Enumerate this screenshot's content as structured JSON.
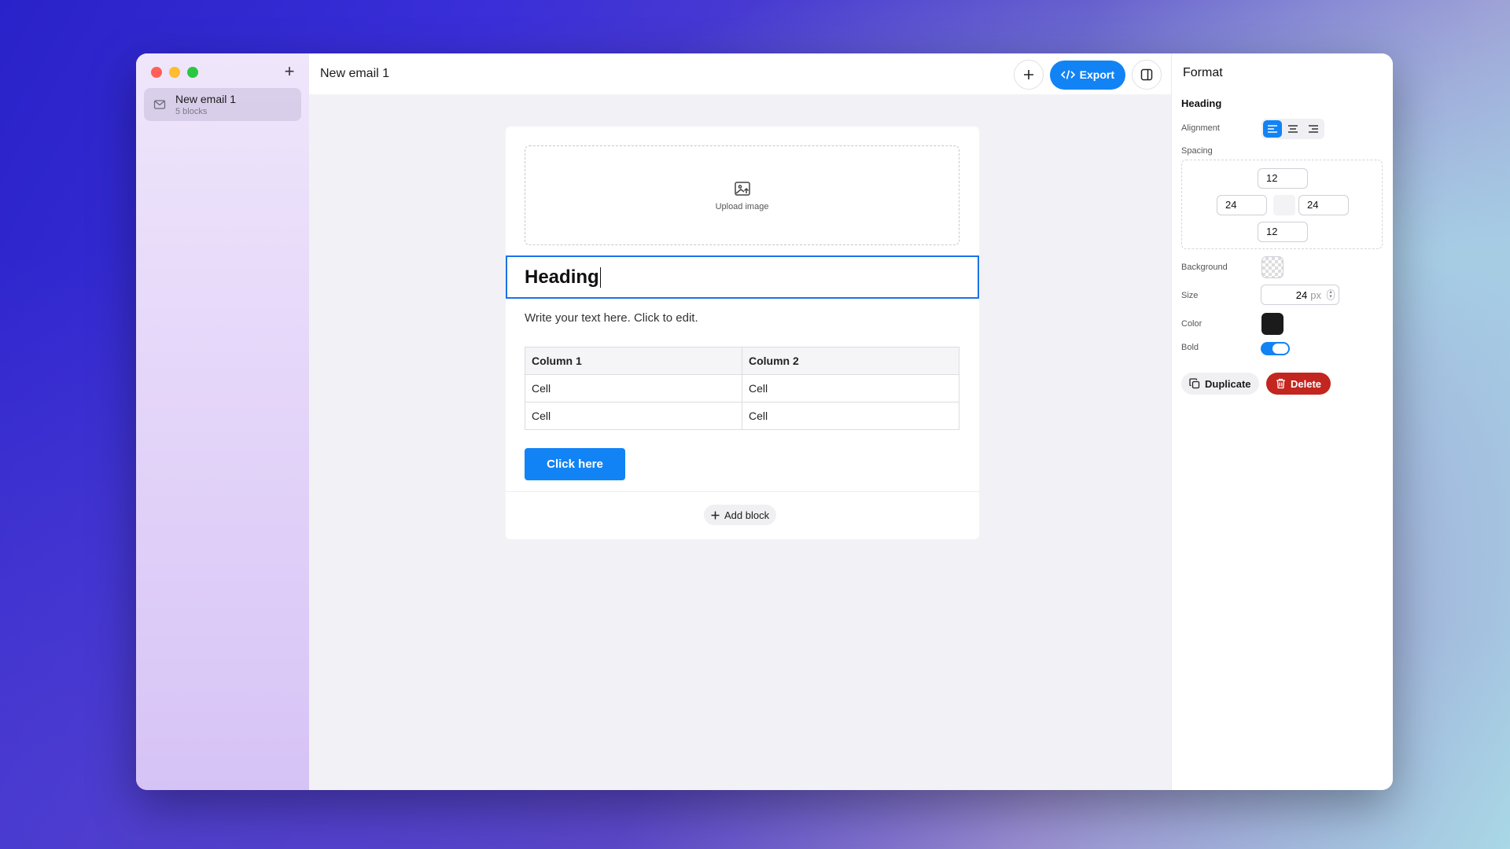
{
  "sidebar": {
    "new_button": "+",
    "items": [
      {
        "title": "New email 1",
        "subtitle": "5 blocks"
      }
    ]
  },
  "header": {
    "title": "New email 1",
    "add_label": "+",
    "export_label": "Export"
  },
  "email": {
    "upload_label": "Upload image",
    "heading": "Heading",
    "paragraph": "Write your text here. Click to edit.",
    "table": {
      "headers": [
        "Column 1",
        "Column 2"
      ],
      "rows": [
        [
          "Cell",
          "Cell"
        ],
        [
          "Cell",
          "Cell"
        ]
      ]
    },
    "button_label": "Click here",
    "add_block_label": "Add block"
  },
  "panel": {
    "title": "Format",
    "section": "Heading",
    "alignment_label": "Alignment",
    "alignment_selected": "left",
    "spacing_label": "Spacing",
    "spacing": {
      "top": "12",
      "left": "24",
      "right": "24",
      "bottom": "12"
    },
    "background_label": "Background",
    "size_label": "Size",
    "size_value": "24",
    "size_unit": "px",
    "color_label": "Color",
    "color_value": "#1b1b1b",
    "bold_label": "Bold",
    "bold_on": true,
    "duplicate_label": "Duplicate",
    "delete_label": "Delete"
  },
  "colors": {
    "accent": "#1283f5",
    "danger": "#c3251f",
    "selection": "#1a73e8"
  }
}
